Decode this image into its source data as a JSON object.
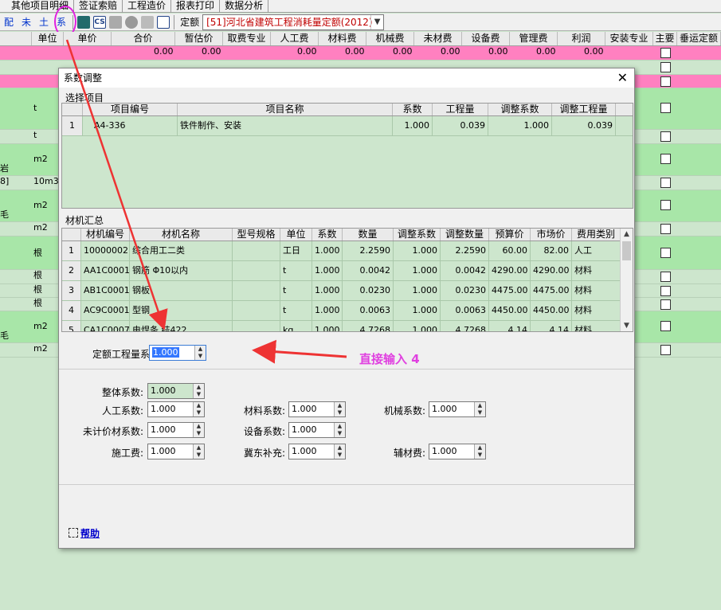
{
  "top_tabs": [
    "其他项目明细",
    "签证索赔",
    "工程造价",
    "报表打印",
    "数据分析"
  ],
  "toolbar": {
    "text_buttons": [
      "配",
      "未",
      "土",
      "系"
    ],
    "quota_label": "定额",
    "quota_value": "[51]河北省建筑工程消耗量定额(2012)"
  },
  "bg_columns": [
    "",
    "单位",
    "单价",
    "合价",
    "暂估价",
    "取费专业",
    "人工费",
    "材料费",
    "机械费",
    "未材费",
    "设备费",
    "管理费",
    "利润",
    "安装专业",
    "主要",
    "垂运定额"
  ],
  "bg_zero": "0.00",
  "bg_units": [
    "t",
    "t",
    "m2",
    "10m3",
    "m2",
    "m2",
    "根",
    "根",
    "根",
    "根",
    "m2",
    "m2"
  ],
  "bg_left_fragments": [
    "岩",
    "8]",
    "毛",
    "毛"
  ],
  "dialog": {
    "title": "系数调整",
    "close": "✕",
    "select_section": "选择项目",
    "select_columns": [
      "",
      "项目编号",
      "项目名称",
      "系数",
      "工程量",
      "调整系数",
      "调整工程量"
    ],
    "select_rows": [
      {
        "idx": "1",
        "code": "A4-336",
        "name": "铁件制作、安装",
        "coef": "1.000",
        "qty": "0.039",
        "adj_coef": "1.000",
        "adj_qty": "0.039"
      }
    ],
    "material_section": "材机汇总",
    "material_columns": [
      "",
      "材机编号",
      "材机名称",
      "型号规格",
      "单位",
      "系数",
      "数量",
      "调整系数",
      "调整数量",
      "预算价",
      "市场价",
      "费用类别"
    ],
    "material_rows": [
      {
        "idx": "1",
        "code": "10000002",
        "name": "综合用工二类",
        "spec": "",
        "unit": "工日",
        "coef": "1.000",
        "qty": "2.2590",
        "adj_coef": "1.000",
        "adj_qty": "2.2590",
        "budget": "60.00",
        "market": "82.00",
        "type": "人工"
      },
      {
        "idx": "2",
        "code": "AA1C0001",
        "name": "钢筋 Φ10以内",
        "spec": "",
        "unit": "t",
        "coef": "1.000",
        "qty": "0.0042",
        "adj_coef": "1.000",
        "adj_qty": "0.0042",
        "budget": "4290.00",
        "market": "4290.00",
        "type": "材料"
      },
      {
        "idx": "3",
        "code": "AB1C0001",
        "name": "钢板",
        "spec": "",
        "unit": "t",
        "coef": "1.000",
        "qty": "0.0230",
        "adj_coef": "1.000",
        "adj_qty": "0.0230",
        "budget": "4475.00",
        "market": "4475.00",
        "type": "材料"
      },
      {
        "idx": "4",
        "code": "AC9C0001",
        "name": "型钢",
        "spec": "",
        "unit": "t",
        "coef": "1.000",
        "qty": "0.0063",
        "adj_coef": "1.000",
        "adj_qty": "0.0063",
        "budget": "4450.00",
        "market": "4450.00",
        "type": "材料"
      },
      {
        "idx": "5",
        "code": "CA1C0007",
        "name": "电焊条 结422",
        "spec": "",
        "unit": "kg",
        "coef": "1.000",
        "qty": "4.7268",
        "adj_coef": "1.000",
        "adj_qty": "4.7268",
        "budget": "4.14",
        "market": "4.14",
        "type": "材料"
      }
    ],
    "quota_coef_label": "定额工程量系数:",
    "quota_coef_value": "1.000",
    "fields": {
      "overall": {
        "label": "整体系数:",
        "value": "1.000"
      },
      "labor": {
        "label": "人工系数:",
        "value": "1.000"
      },
      "material": {
        "label": "材料系数:",
        "value": "1.000"
      },
      "machine": {
        "label": "机械系数:",
        "value": "1.000"
      },
      "uncounted": {
        "label": "未计价材系数:",
        "value": "1.000"
      },
      "equipment": {
        "label": "设备系数:",
        "value": "1.000"
      },
      "construction": {
        "label": "施工费:",
        "value": "1.000"
      },
      "jidong": {
        "label": "冀东补充:",
        "value": "1.000"
      },
      "aux": {
        "label": "辅材费:",
        "value": "1.000"
      }
    },
    "help": "帮助"
  },
  "annotation": "直接输入 4",
  "colors": {
    "pink": "#ff80c0",
    "green": "#cde6cd",
    "bright_green": "#a8e6a8",
    "annotation": "#e040e0",
    "arrow": "#ee3333"
  }
}
